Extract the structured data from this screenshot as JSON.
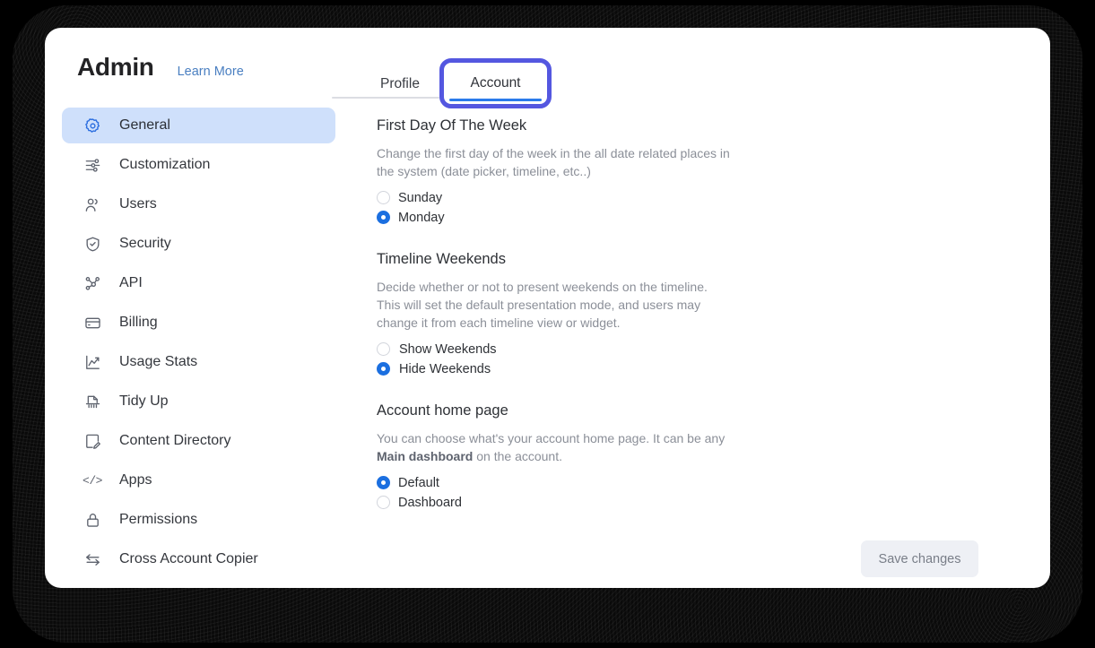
{
  "window": {
    "backdrop_color": "#000000",
    "card_background": "#ffffff"
  },
  "sidebar": {
    "app_title": "Admin",
    "learn_more_label": "Learn More",
    "active_item": "General",
    "active_background": "#cfe0fb",
    "items": [
      {
        "label": "General",
        "icon": "gear-icon",
        "active": true
      },
      {
        "label": "Customization",
        "icon": "sliders-icon",
        "active": false
      },
      {
        "label": "Users",
        "icon": "users-icon",
        "active": false
      },
      {
        "label": "Security",
        "icon": "shield-check-icon",
        "active": false
      },
      {
        "label": "API",
        "icon": "nodes-icon",
        "active": false
      },
      {
        "label": "Billing",
        "icon": "credit-card-icon",
        "active": false
      },
      {
        "label": "Usage Stats",
        "icon": "line-chart-icon",
        "active": false
      },
      {
        "label": "Tidy Up",
        "icon": "shredder-icon",
        "active": false
      },
      {
        "label": "Content Directory",
        "icon": "document-edit-icon",
        "active": false
      },
      {
        "label": "Apps",
        "icon": "code-icon",
        "active": false
      },
      {
        "label": "Permissions",
        "icon": "lock-icon",
        "active": false
      },
      {
        "label": "Cross Account Copier",
        "icon": "transfer-arrows-icon",
        "active": false
      }
    ]
  },
  "tabs": {
    "items": [
      {
        "label": "Profile",
        "selected": false
      },
      {
        "label": "Account",
        "selected": true
      }
    ],
    "focus_ring_color": "#5457e0",
    "underline_color": "#2b7bea"
  },
  "sections": [
    {
      "title": "First Day Of The Week",
      "description": "Change the first day of the week in the all date related places in the system (date picker, timeline, etc..)",
      "options": [
        {
          "label": "Sunday",
          "checked": false
        },
        {
          "label": "Monday",
          "checked": true
        }
      ]
    },
    {
      "title": "Timeline Weekends",
      "description": "Decide whether or not to present weekends on the timeline. This will set the default presentation mode, and users may change it from each timeline view or widget.",
      "options": [
        {
          "label": "Show Weekends",
          "checked": false
        },
        {
          "label": "Hide Weekends",
          "checked": true
        }
      ]
    },
    {
      "title": "Account home page",
      "description_parts": [
        {
          "text": "You can choose what's your account home page. It can be any ",
          "bold": false
        },
        {
          "text": "Main dashboard",
          "bold": true
        },
        {
          "text": " on the account.",
          "bold": false
        }
      ],
      "options": [
        {
          "label": "Default",
          "checked": true
        },
        {
          "label": "Dashboard",
          "checked": false
        }
      ]
    }
  ],
  "footer": {
    "save_label": "Save changes",
    "save_background": "#eef0f5",
    "save_text_color": "#797e88"
  },
  "colors": {
    "radio_selected": "#1b6fe0",
    "link": "#4a7fc1",
    "title_text": "#232325",
    "muted_text": "#8b8f98"
  }
}
